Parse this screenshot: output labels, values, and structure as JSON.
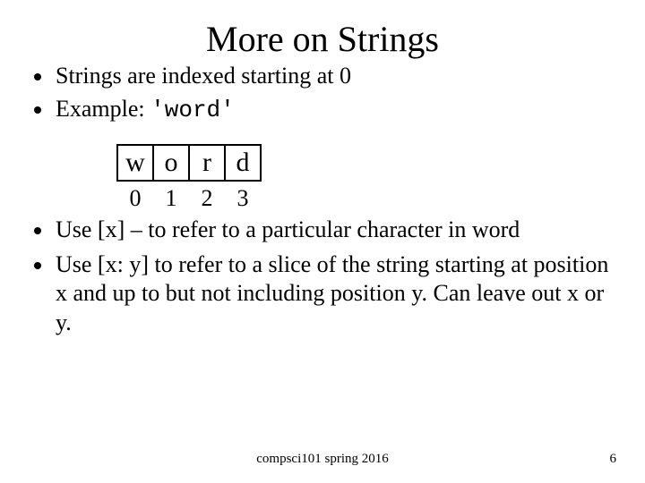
{
  "title": "More on Strings",
  "bullets_top": [
    "Strings are indexed starting at 0",
    "Example: "
  ],
  "example_code": "'word'",
  "cells": [
    "w",
    "o",
    "r",
    "d"
  ],
  "indices": [
    "0",
    "1",
    "2",
    "3"
  ],
  "bullets_bottom": [
    "Use [x] – to refer to a particular character in word",
    "Use [x: y] to refer to a slice of the string starting at position x and up to but not including position y. Can leave out x or y."
  ],
  "footer": "compsci101 spring 2016",
  "page_number": "6"
}
